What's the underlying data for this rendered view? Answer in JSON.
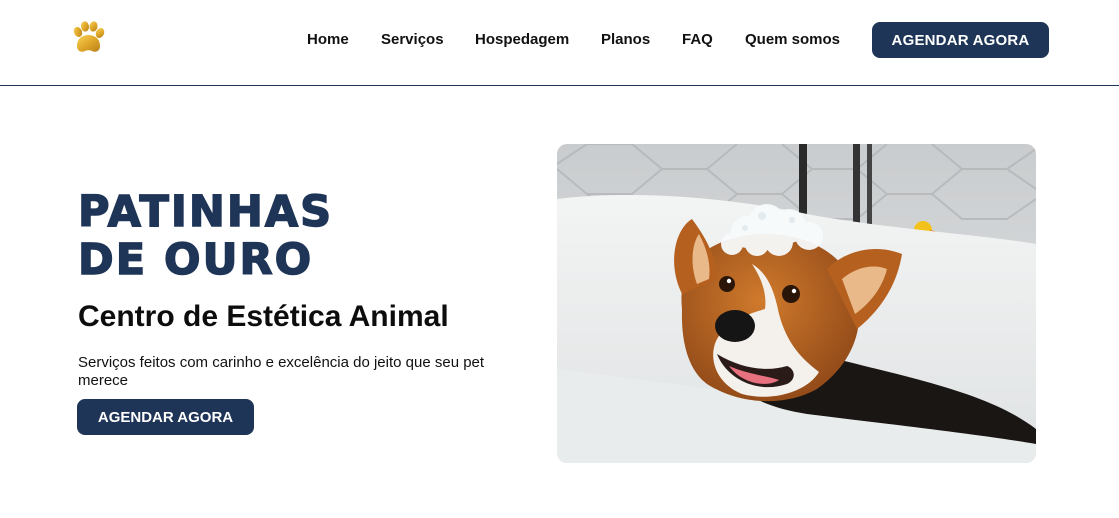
{
  "header": {
    "logo_icon": "paw-icon",
    "nav": [
      {
        "label": "Home"
      },
      {
        "label": "Serviços"
      },
      {
        "label": "Hospedagem"
      },
      {
        "label": "Planos"
      },
      {
        "label": "FAQ"
      },
      {
        "label": "Quem somos"
      }
    ],
    "cta_label": "AGENDAR AGORA"
  },
  "hero": {
    "title_line1": "PATINHAS",
    "title_line2": "DE OURO",
    "subtitle": "Centro de Estética Animal",
    "description": "Serviços feitos com carinho e excelência do jeito que seu pet merece",
    "cta_label": "AGENDAR AGORA",
    "image_subject": "corgi-in-bathtub-photo"
  },
  "colors": {
    "brand_navy": "#1e3557",
    "logo_gold": "#e0a82a",
    "text": "#111111",
    "background": "#ffffff"
  }
}
